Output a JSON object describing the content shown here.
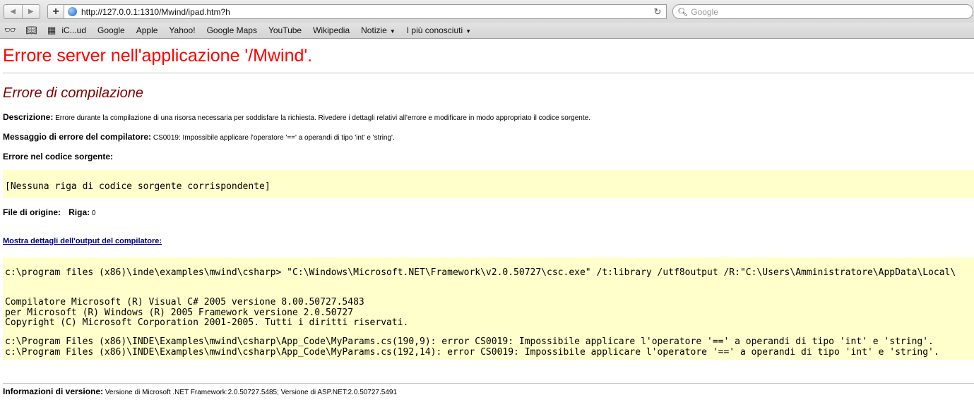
{
  "browser": {
    "url": "http://127.0.0.1:1310/Mwind/ipad.htm?h",
    "search_placeholder": "Google"
  },
  "bookmarks": [
    "iC...ud",
    "Google",
    "Apple",
    "Yahoo!",
    "Google Maps",
    "YouTube",
    "Wikipedia",
    "Notizie",
    "I più conosciuti"
  ],
  "page": {
    "title": "Errore server nell'applicazione '/Mwind'.",
    "subtitle": "Errore di compilazione",
    "description_label": "Descrizione:",
    "description": "Errore durante la compilazione di una risorsa necessaria per soddisfare la richiesta. Rivedere i dettagli relativi all'errore e modificare in modo appropriato il codice sorgente.",
    "compiler_message_label": "Messaggio di errore del compilatore:",
    "compiler_message": "CS0019: Impossibile applicare l'operatore '==' a operandi di tipo 'int' e 'string'.",
    "source_error_label": "Errore nel codice sorgente:",
    "source_code": "[Nessuna riga di codice sorgente corrispondente]",
    "source_file_label": "File di origine:",
    "line_label": "Riga:",
    "line_value": "0",
    "show_output_link": "Mostra dettagli dell'output del compilatore:",
    "compiler_command": "c:\\program files (x86)\\inde\\examples\\mwind\\csharp> \"C:\\Windows\\Microsoft.NET\\Framework\\v2.0.50727\\csc.exe\" /t:library /utf8output /R:\"C:\\Users\\Amministratore\\AppData\\Local\\",
    "compiler_banner_1": "Compilatore Microsoft (R) Visual C# 2005 versione 8.00.50727.5483",
    "compiler_banner_2": "per Microsoft (R) Windows (R) 2005 Framework versione 2.0.50727",
    "compiler_banner_3": "Copyright (C) Microsoft Corporation 2001-2005. Tutti i diritti riservati.",
    "error_line_1": "c:\\Program Files (x86)\\INDE\\Examples\\mwind\\csharp\\App_Code\\MyParams.cs(190,9): error CS0019: Impossibile applicare l'operatore '==' a operandi di tipo 'int' e 'string'.",
    "error_line_2": "c:\\Program Files (x86)\\INDE\\Examples\\mwind\\csharp\\App_Code\\MyParams.cs(192,14): error CS0019: Impossibile applicare l'operatore '==' a operandi di tipo 'int' e 'string'.",
    "version_label": "Informazioni di versione:",
    "version_text": "Versione di Microsoft .NET Framework:2.0.50727.5485; Versione di ASP.NET:2.0.50727.5491"
  }
}
